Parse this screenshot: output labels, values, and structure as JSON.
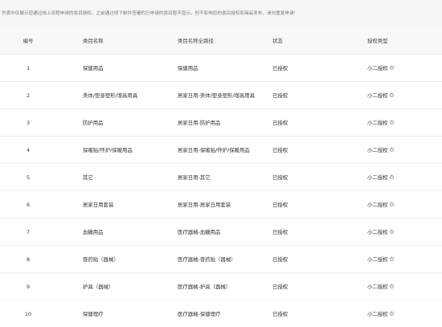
{
  "notice": "列表中仅展示您通过线上流程申请的类目授权，之前通过线下邮件签署的已申请的类目暂不显示，但不影响您的类目授权和商品发布，请勿重复申请!",
  "columns": {
    "num": "编号",
    "name": "类目名称",
    "path": "类目名称全路径",
    "status": "状态",
    "type": "授权类型"
  },
  "rows": [
    {
      "num": "1",
      "name": "保健用品",
      "path": "保健用品",
      "status": "已授权",
      "type": "小二授权"
    },
    {
      "num": "2",
      "name": "美体/塑身塑形/增高用具",
      "path": "居家日用-美体/塑身塑形/增高用具",
      "status": "已授权",
      "type": "小二授权"
    },
    {
      "num": "3",
      "name": "防护用品",
      "path": "居家日用-防护用品",
      "status": "已授权",
      "type": "小二授权"
    },
    {
      "num": "4",
      "name": "保暖贴/怀炉/保暖用品",
      "path": "居家日用-保暖贴/怀炉/保暖用品",
      "status": "已授权",
      "type": "小二授权"
    },
    {
      "num": "5",
      "name": "其它",
      "path": "居家日用-其它",
      "status": "已授权",
      "type": "小二授权"
    },
    {
      "num": "6",
      "name": "居家日用套装",
      "path": "居家日用-居家日用套装",
      "status": "已授权",
      "type": "小二授权"
    },
    {
      "num": "7",
      "name": "血糖用品",
      "path": "医疗器械-血糖用品",
      "status": "已授权",
      "type": "小二授权"
    },
    {
      "num": "8",
      "name": "膏药贴（器械）",
      "path": "医疗器械-膏药贴（器械）",
      "status": "已授权",
      "type": "小二授权"
    },
    {
      "num": "9",
      "name": "护具（器械）",
      "path": "医疗器械-护具（器械）",
      "status": "已授权",
      "type": "小二授权"
    },
    {
      "num": "10",
      "name": "保健理疗",
      "path": "医疗器械-保健理疗",
      "status": "已授权",
      "type": "小二授权"
    }
  ],
  "icons": {
    "help": "question-circle-icon"
  },
  "colors": {
    "notice_bg": "#f5f6f7",
    "header_bg": "#f7f8fa",
    "border": "#eeeeee"
  }
}
